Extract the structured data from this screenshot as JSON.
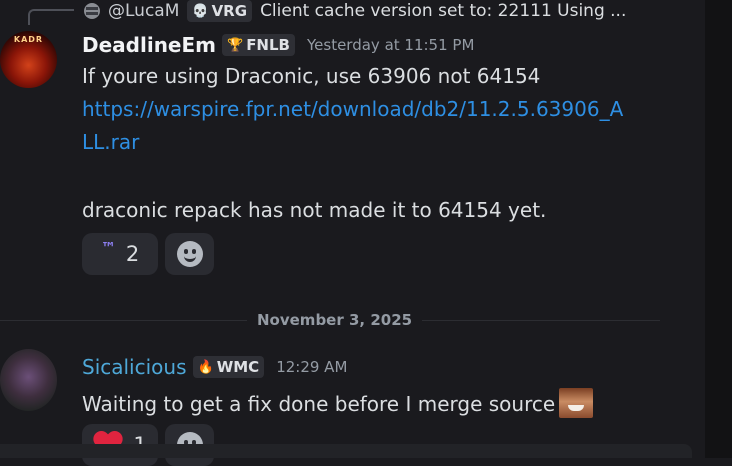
{
  "reply": {
    "author": "@LucaM",
    "tag": "VRG",
    "tag_icon": "skull-icon",
    "text": "Client cache version set to: 22111 Using ..."
  },
  "message1": {
    "author": "DeadlineEm",
    "tag": "FNLB",
    "tag_icon": "trophy-icon",
    "timestamp": "Yesterday at 11:51 PM",
    "avatar_text": "KADR",
    "lines": [
      "If youre using Draconic, use 63906 not 64154",
      "https://warspire.fpr.net/download/db2/11.2.5.63906_A",
      "LL.rar",
      "draconic repack has not made it to 64154 yet."
    ],
    "reaction": {
      "emoji": "™",
      "count": "2"
    }
  },
  "divider": {
    "label": "November 3, 2025"
  },
  "message2": {
    "author": "Sicalicious",
    "tag": "WMC",
    "tag_icon": "flame-icon",
    "timestamp": "12:29 AM",
    "text": "Waiting to get a fix done before I merge source",
    "reaction": {
      "emoji": "heart",
      "count": "1"
    }
  },
  "colors": {
    "background": "#1a1a1e",
    "link": "#2e8fe3",
    "author2": "#4ea8d8",
    "heart": "#e0243f"
  }
}
